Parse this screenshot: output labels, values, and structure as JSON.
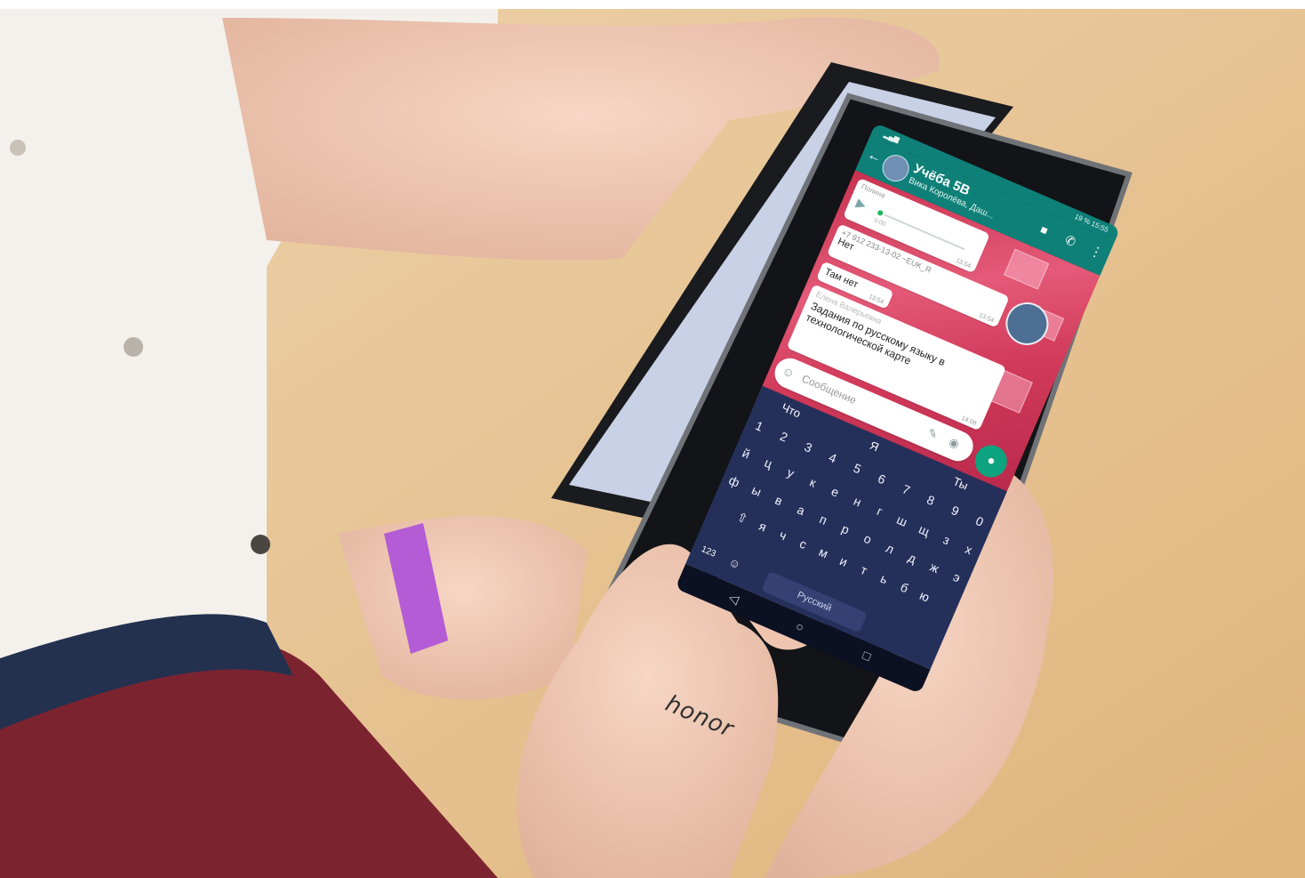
{
  "colors": {
    "header": "#0e8078",
    "wallpaper": "#d23a5a",
    "keyboard": "#25305a",
    "mic": "#0ea37f",
    "desk": "#e7c08d",
    "shirt_white": "#f4f1ec",
    "shirt_maroon": "#7c2330",
    "wristband": "#b45bd6"
  },
  "phone": {
    "brand": "honor",
    "status_bar": {
      "battery": "19 % 15:55"
    },
    "chat_header": {
      "back_icon": "arrow-left-icon",
      "title": "Учёба 5В",
      "subtitle": "Вика Королёва, Даш...",
      "video_icon": "video-camera-icon",
      "call_icon": "phone-icon",
      "menu_icon": "kebab-menu-icon"
    },
    "messages": [
      {
        "type": "voice",
        "sender": "Полина",
        "duration": "0:00",
        "time": "13:54"
      },
      {
        "type": "text",
        "sender": "+7 912 233-13-02 ~EUK_R",
        "text": "Нет",
        "time": "13:54"
      },
      {
        "type": "text",
        "text": "Там нет",
        "time": "13:54"
      },
      {
        "type": "text",
        "sender": "Елена Валерьевна",
        "text": "Задания по русскому языку в технологической карте",
        "time": "14:09"
      }
    ],
    "input": {
      "placeholder": "Сообщение"
    },
    "keyboard": {
      "suggestions": [
        "Что",
        "Я",
        "Ты"
      ],
      "rows": [
        [
          "1",
          "2",
          "3",
          "4",
          "5",
          "6",
          "7",
          "8",
          "9",
          "0"
        ],
        [
          "й",
          "ц",
          "у",
          "к",
          "е",
          "н",
          "г",
          "ш",
          "щ",
          "з",
          "х"
        ],
        [
          "ф",
          "ы",
          "в",
          "а",
          "п",
          "р",
          "о",
          "л",
          "д",
          "ж",
          "э"
        ],
        [
          "я",
          "ч",
          "с",
          "м",
          "и",
          "т",
          "ь",
          "б",
          "ю"
        ]
      ],
      "numbers_key": "123",
      "language_key": "Русский"
    }
  }
}
